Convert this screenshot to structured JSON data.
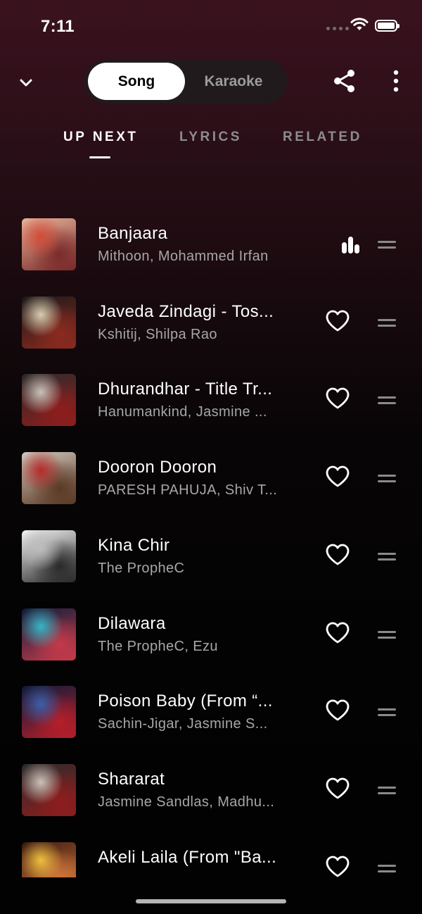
{
  "status_bar": {
    "time": "7:11"
  },
  "header": {
    "segments": [
      {
        "label": "Song",
        "active": true
      },
      {
        "label": "Karaoke",
        "active": false
      }
    ],
    "icons": [
      "chevron-down-icon",
      "share-icon",
      "more-vertical-icon"
    ]
  },
  "tabs": [
    {
      "label": "UP NEXT",
      "active": true
    },
    {
      "label": "LYRICS",
      "active": false
    },
    {
      "label": "RELATED",
      "active": false
    }
  ],
  "queue": [
    {
      "title": "Banjaara",
      "artist": "Mithoon, Mohammed Irfan",
      "now_playing": true,
      "art": [
        "#e8b39a",
        "#7a2b2a",
        "#d24b37"
      ]
    },
    {
      "title": "Javeda Zindagi - Tos...",
      "artist": "Kshitij, Shilpa Rao",
      "now_playing": false,
      "art": [
        "#1a1a1a",
        "#8a2a1f",
        "#d8cdb0"
      ]
    },
    {
      "title": "Dhurandhar - Title Tr...",
      "artist": "Hanumankind, Jasmine ...",
      "now_playing": false,
      "art": [
        "#2b2b2b",
        "#8e1d1d",
        "#c9c2b8"
      ]
    },
    {
      "title": "Dooron Dooron",
      "artist": "PARESH PAHUJA, Shiv T...",
      "now_playing": false,
      "art": [
        "#cfc6bb",
        "#5b3a25",
        "#b52b2b"
      ]
    },
    {
      "title": "Kina Chir",
      "artist": "The PropheC",
      "now_playing": false,
      "art": [
        "#f2f2f2",
        "#2a2a2a",
        "#bdbdbd"
      ]
    },
    {
      "title": "Dilawara",
      "artist": "The PropheC, Ezu",
      "now_playing": false,
      "art": [
        "#0f1d3a",
        "#c23a4a",
        "#36b5c6"
      ]
    },
    {
      "title": "Poison Baby (From “...",
      "artist": "Sachin-Jigar, Jasmine S...",
      "now_playing": false,
      "art": [
        "#0d1a3a",
        "#b41f2a",
        "#3b5fa8"
      ]
    },
    {
      "title": "Shararat",
      "artist": "Jasmine Sandlas, Madhu...",
      "now_playing": false,
      "art": [
        "#2b2b2b",
        "#8e1d1d",
        "#c9c2b8"
      ]
    },
    {
      "title": "Akeli Laila (From \"Ba...",
      "artist": "",
      "now_playing": false,
      "art": [
        "#3a1a12",
        "#d1763a",
        "#f0c040"
      ]
    }
  ]
}
